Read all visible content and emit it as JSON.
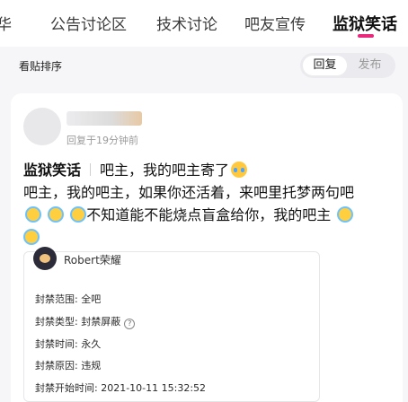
{
  "tabs": [
    {
      "label": "华"
    },
    {
      "label": "公告讨论区"
    },
    {
      "label": "技术讨论"
    },
    {
      "label": "吧友宣传"
    },
    {
      "label": "监狱笑话"
    }
  ],
  "colors": {
    "accent": "#e7287b"
  },
  "sort": {
    "label": "看贴排序",
    "options": [
      "回复",
      "发布"
    ],
    "selected": "回复"
  },
  "post": {
    "reply_time": "回复于19分钟前",
    "forum": "监狱笑话",
    "title": "吧主，我的吧主寄了",
    "body_line1": "吧主，我的吧主，如果你还活着，来吧里托梦两句吧",
    "body_line2": "不知道能不能烧点盲盒给你，我的吧主"
  },
  "ban_record": {
    "user": "Robert荣耀",
    "scope": "封禁范围: 全吧",
    "type": "封禁类型: 封禁屏蔽",
    "duration": "封禁时间: 永久",
    "reason": "封禁原因: 违规",
    "start": "封禁开始时间: 2021-10-11 15:32:52"
  },
  "icons": {
    "help": "question-circle-icon",
    "cry": "crying-face-icon",
    "angel": "halo-face-icon"
  }
}
